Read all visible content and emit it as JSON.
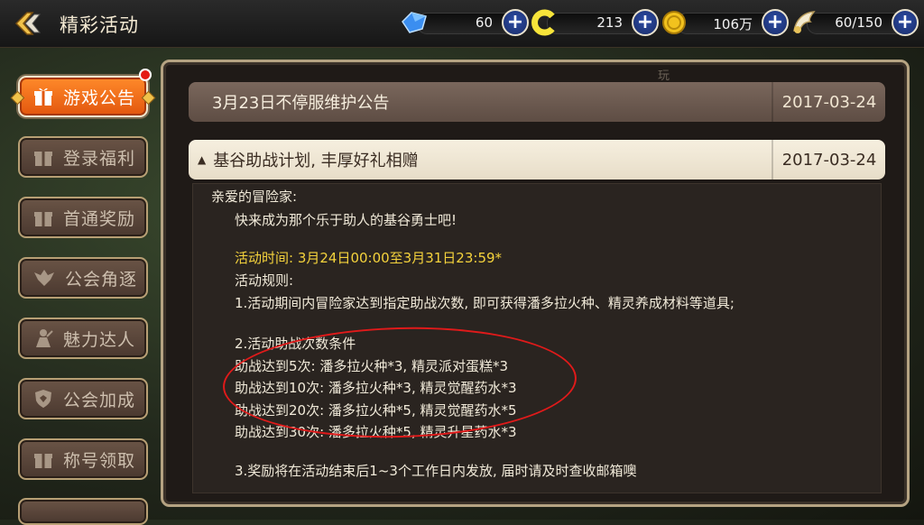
{
  "header": {
    "title": "精彩活动",
    "resources": [
      {
        "icon": "blue-gem-icon",
        "value": "60"
      },
      {
        "icon": "yellow-c-coin-icon",
        "value": "213"
      },
      {
        "icon": "gold-coin-icon",
        "value": "106万"
      },
      {
        "icon": "wing-stamina-icon",
        "value": "60/150"
      }
    ]
  },
  "sidebar": {
    "items": [
      {
        "label": "游戏公告",
        "icon": "gift-icon",
        "active": true,
        "notification": true
      },
      {
        "label": "登录福利",
        "icon": "gift-icon"
      },
      {
        "label": "首通奖励",
        "icon": "gift-icon"
      },
      {
        "label": "公会角逐",
        "icon": "guild-crest-icon"
      },
      {
        "label": "魅力达人",
        "icon": "charm-figure-icon"
      },
      {
        "label": "公会加成",
        "icon": "shield-icon"
      },
      {
        "label": "称号领取",
        "icon": "gift-icon"
      }
    ]
  },
  "panel": {
    "tag": "玩",
    "notices": [
      {
        "title": "3月23日不停服维护公告",
        "date": "2017-03-24",
        "expanded": false
      },
      {
        "title": "基谷助战计划, 丰厚好礼相赠",
        "date": "2017-03-24",
        "expanded": true
      }
    ],
    "content": {
      "greeting": "亲爱的冒险家:",
      "intro": "快来成为那个乐于助人的基谷勇士吧!",
      "time": "活动时间: 3月24日00:00至3月31日23:59*",
      "rules_title": "活动规则:",
      "rule1": "1.活动期间内冒险家达到指定助战次数, 即可获得潘多拉火种、精灵养成材料等道具;",
      "rule2_title": "2.活动助战次数条件",
      "tiers": [
        "助战达到5次: 潘多拉火种*3, 精灵派对蛋糕*3",
        "助战达到10次: 潘多拉火种*3, 精灵觉醒药水*3",
        "助战达到20次: 潘多拉火种*5, 精灵觉醒药水*5",
        "助战达到30次: 潘多拉火种*5, 精灵升星药水*3"
      ],
      "rule3": "3.奖励将在活动结束后1~3个工作日内发放, 届时请及时查收邮箱噢"
    }
  },
  "colors": {
    "accent_orange": "#e2560e",
    "highlight_yellow": "#f5d33c",
    "annotation_red": "#e01a1a"
  }
}
